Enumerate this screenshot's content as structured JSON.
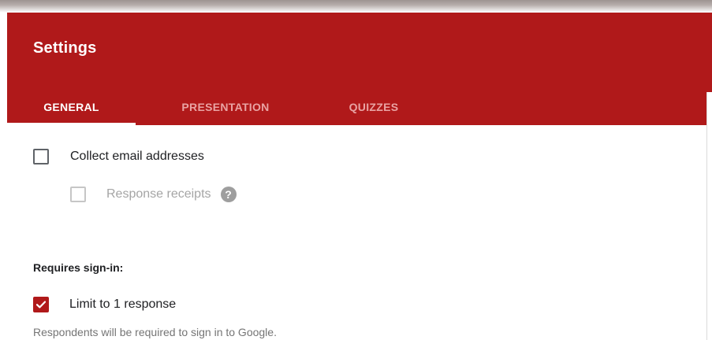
{
  "dialog": {
    "title": "Settings"
  },
  "tabs": [
    {
      "label": "GENERAL",
      "active": true
    },
    {
      "label": "PRESENTATION",
      "active": false
    },
    {
      "label": "QUIZZES",
      "active": false
    }
  ],
  "general": {
    "collect_email": {
      "label": "Collect email addresses",
      "checked": false
    },
    "response_receipts": {
      "label": "Response receipts",
      "checked": false,
      "disabled": true,
      "help_icon": "help-circle-icon"
    },
    "sign_in_heading": "Requires sign-in:",
    "limit_response": {
      "label": "Limit to 1 response",
      "checked": true
    },
    "limit_hint": "Respondents will be required to sign in to Google."
  },
  "colors": {
    "header": "#b0191a",
    "accent": "#b0191a",
    "tab_inactive": "#e9a3a3"
  }
}
